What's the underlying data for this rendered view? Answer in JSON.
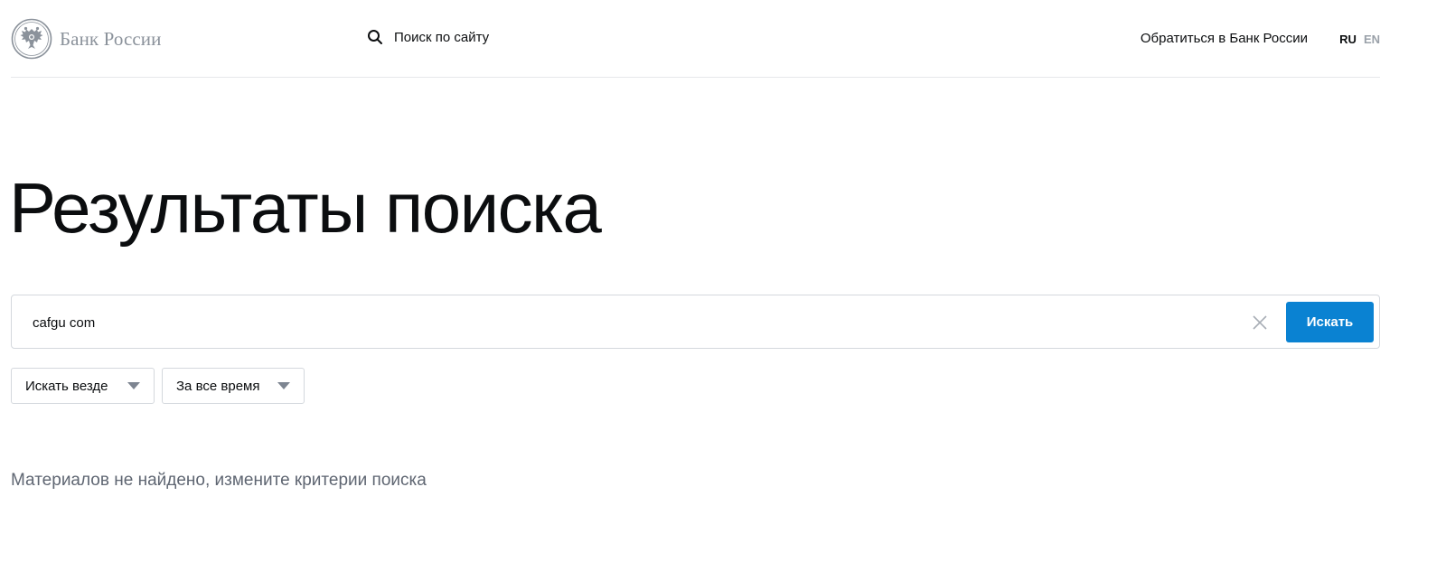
{
  "header": {
    "logo_text": "Банк России",
    "logo_icon": "double-headed-eagle-emblem",
    "search_label": "Поиск по сайту",
    "search_icon": "search-icon",
    "contact_link": "Обратиться в Банк России",
    "languages": [
      "RU",
      "EN"
    ],
    "active_language": "RU"
  },
  "main": {
    "title": "Результаты поиска",
    "search": {
      "value": "cafgu com",
      "clear_icon": "close-icon",
      "submit_label": "Искать"
    },
    "filters": {
      "where": "Искать везде",
      "when": "За все время"
    },
    "empty_message": "Материалов не найдено, измените критерии поиска"
  },
  "colors": {
    "accent": "#0a82d2",
    "text": "#0b0d0f",
    "muted": "#5f6672",
    "border": "#d4d8dd"
  }
}
